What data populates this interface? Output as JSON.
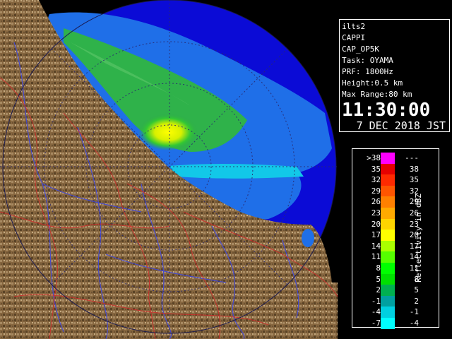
{
  "info": {
    "station": "ilts2",
    "product": "CAPPI",
    "mode": "CAP_OP5K",
    "task": "Task: OYAMA",
    "prf": "PRF: 1800Hz",
    "height": "Height:0.5 km",
    "max_range": "Max Range:80 km",
    "time": "11:30:00",
    "date": "7 DEC 2018 JST"
  },
  "legend": {
    "title": "Reflectivity in dBZ",
    "rows": [
      {
        "lo": ">38",
        "hi": "---",
        "color": "#ff00ff"
      },
      {
        "lo": "35",
        "hi": "38",
        "color": "#e60000"
      },
      {
        "lo": "32",
        "hi": "35",
        "color": "#ff2a00"
      },
      {
        "lo": "29",
        "hi": "32",
        "color": "#ff5500"
      },
      {
        "lo": "26",
        "hi": "29",
        "color": "#ff8000"
      },
      {
        "lo": "23",
        "hi": "26",
        "color": "#ffaa00"
      },
      {
        "lo": "20",
        "hi": "23",
        "color": "#ffd500"
      },
      {
        "lo": "17",
        "hi": "20",
        "color": "#ffff00"
      },
      {
        "lo": "14",
        "hi": "17",
        "color": "#aaff00"
      },
      {
        "lo": "11",
        "hi": "14",
        "color": "#55ff00"
      },
      {
        "lo": "8",
        "hi": "11",
        "color": "#00ff00"
      },
      {
        "lo": "5",
        "hi": "8",
        "color": "#00e000"
      },
      {
        "lo": "2",
        "hi": "5",
        "color": "#00b050"
      },
      {
        "lo": "-1",
        "hi": "2",
        "color": "#00a0a0"
      },
      {
        "lo": "-4",
        "hi": "-1",
        "color": "#00d0e0"
      },
      {
        "lo": "-7",
        "hi": "-4",
        "color": "#00ffff"
      }
    ]
  },
  "colors": {
    "ocean": "#0b0bd6",
    "echo_light": "#1f6fe8",
    "echo_cyan": "#12c8e8",
    "echo_green": "#2fb24a",
    "echo_core": "#ffff00",
    "land": "#8a6a46",
    "rivers": "#3c46e6",
    "borders": "#d42a2a",
    "grid": "#2a2a70"
  }
}
